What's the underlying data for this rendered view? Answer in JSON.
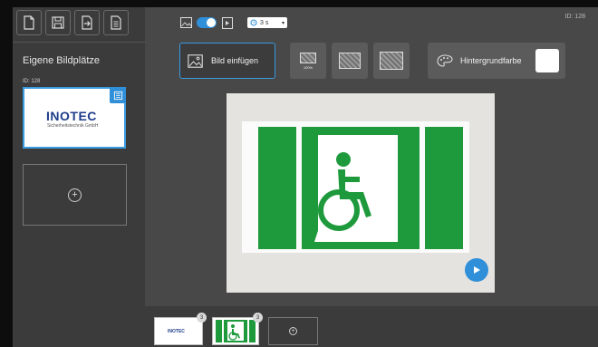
{
  "toolbar": {
    "buttons": [
      {
        "icon": "new-file-icon"
      },
      {
        "icon": "save-icon"
      },
      {
        "icon": "export-icon"
      },
      {
        "icon": "list-file-icon"
      }
    ]
  },
  "sidebar": {
    "title": "Eigene Bildplätze",
    "tile_id": "ID: 128",
    "logo_tile": {
      "brand": "INOTEC",
      "subtitle": "Sicherheitstechnik GmbH"
    }
  },
  "main": {
    "id_label": "ID: 128",
    "duration": "3 s",
    "insert_button": "Bild einfügen",
    "view_buttons": [
      {
        "label": "100%"
      },
      {
        "label": ""
      },
      {
        "label": ""
      }
    ],
    "bg_button": "Hintergrundfarbe",
    "bg_color": "#ffffff"
  },
  "sign": {
    "green": "#1e9a3c",
    "symbol": "wheelchair-exit-icon"
  },
  "bottom": {
    "thumbnails": [
      {
        "kind": "logo",
        "text": "INOTEC",
        "number": "3"
      },
      {
        "kind": "sign",
        "number": "3"
      },
      {
        "kind": "add"
      }
    ]
  }
}
